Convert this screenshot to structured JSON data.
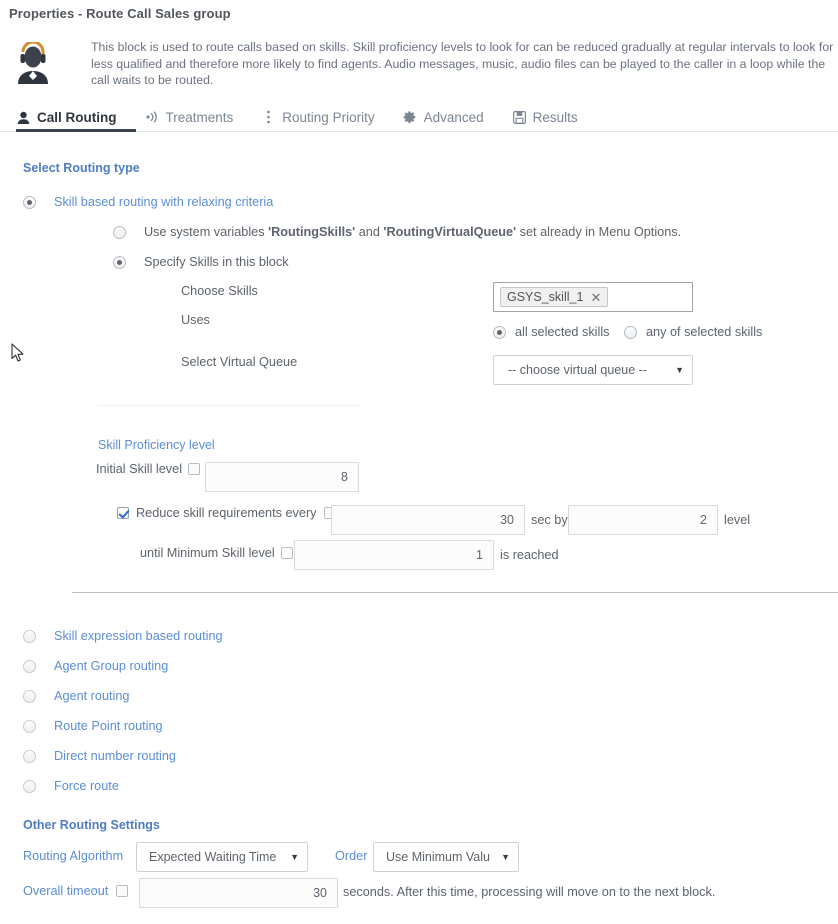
{
  "window": {
    "title": "Properties - Route Call Sales group",
    "icon": "agent-headset-icon"
  },
  "description": "This block is used to route calls based on skills. Skill proficiency levels to look for can be reduced gradually at regular intervals to look for less qualified and therefore more likely to find agents. Audio messages, music, audio files can be played to the caller in a loop while the call waits to be routed.",
  "tabs": [
    {
      "label": "Call Routing",
      "icon": "agent-icon",
      "active": true
    },
    {
      "label": "Treatments",
      "icon": "sound-wave-icon",
      "active": false
    },
    {
      "label": "Routing Priority",
      "icon": "vertical-dots-icon",
      "active": false
    },
    {
      "label": "Advanced",
      "icon": "gear-icon",
      "active": false
    },
    {
      "label": "Results",
      "icon": "save-disk-icon",
      "active": false
    }
  ],
  "routing_type": {
    "heading": "Select Routing type",
    "options": [
      {
        "label": "Skill based routing with relaxing criteria",
        "selected": true
      },
      {
        "label": "Skill expression based routing",
        "selected": false
      },
      {
        "label": "Agent Group routing",
        "selected": false
      },
      {
        "label": "Agent routing",
        "selected": false
      },
      {
        "label": "Route Point routing",
        "selected": false
      },
      {
        "label": "Direct number routing",
        "selected": false
      },
      {
        "label": "Force route",
        "selected": false
      }
    ]
  },
  "skill_source": {
    "system_vars": {
      "prefix": "Use system variables ",
      "var1": "'RoutingSkills'",
      "middle": " and ",
      "var2": "'RoutingVirtualQueue'",
      "suffix": " set already in Menu Options.",
      "selected": false
    },
    "specify": {
      "label": "Specify Skills in this block",
      "selected": true
    }
  },
  "skills": {
    "choose_label": "Choose Skills",
    "tokens": [
      {
        "name": "GSYS_skill_1",
        "remove_icon": "close-icon"
      }
    ],
    "uses_label": "Uses",
    "uses_options": [
      {
        "label": "all selected skills",
        "selected": true
      },
      {
        "label": "any of selected skills",
        "selected": false
      }
    ],
    "virtual_queue_label": "Select Virtual Queue",
    "virtual_queue_value": "-- choose virtual queue --"
  },
  "proficiency": {
    "heading": "Skill Proficiency level",
    "initial_label": "Initial Skill level",
    "initial_value": "8",
    "initial_var_checked": false,
    "reduce_label": "Reduce skill requirements every",
    "reduce_checked": true,
    "reduce_interval": "30",
    "reduce_interval_var_checked": false,
    "sec_by_label": "sec by",
    "reduce_step": "2",
    "level_label": "level",
    "until_label": "until Minimum Skill level",
    "until_var_checked": false,
    "minimum_value": "1",
    "is_reached_label": "is reached"
  },
  "other_settings": {
    "heading": "Other Routing Settings",
    "algorithm_label": "Routing Algorithm",
    "algorithm_value": "Expected Waiting Time",
    "order_label": "Order",
    "order_value": "Use Minimum Valu",
    "timeout_label": "Overall timeout",
    "timeout_var_checked": false,
    "timeout_value": "30",
    "timeout_suffix": "seconds. After this time, processing will move on to the next block."
  },
  "colors": {
    "accent_blue": "#4f7dc0",
    "link_blue": "#5b8ed2",
    "text_gray": "#5d646c",
    "tab_active": "#2f3640"
  }
}
